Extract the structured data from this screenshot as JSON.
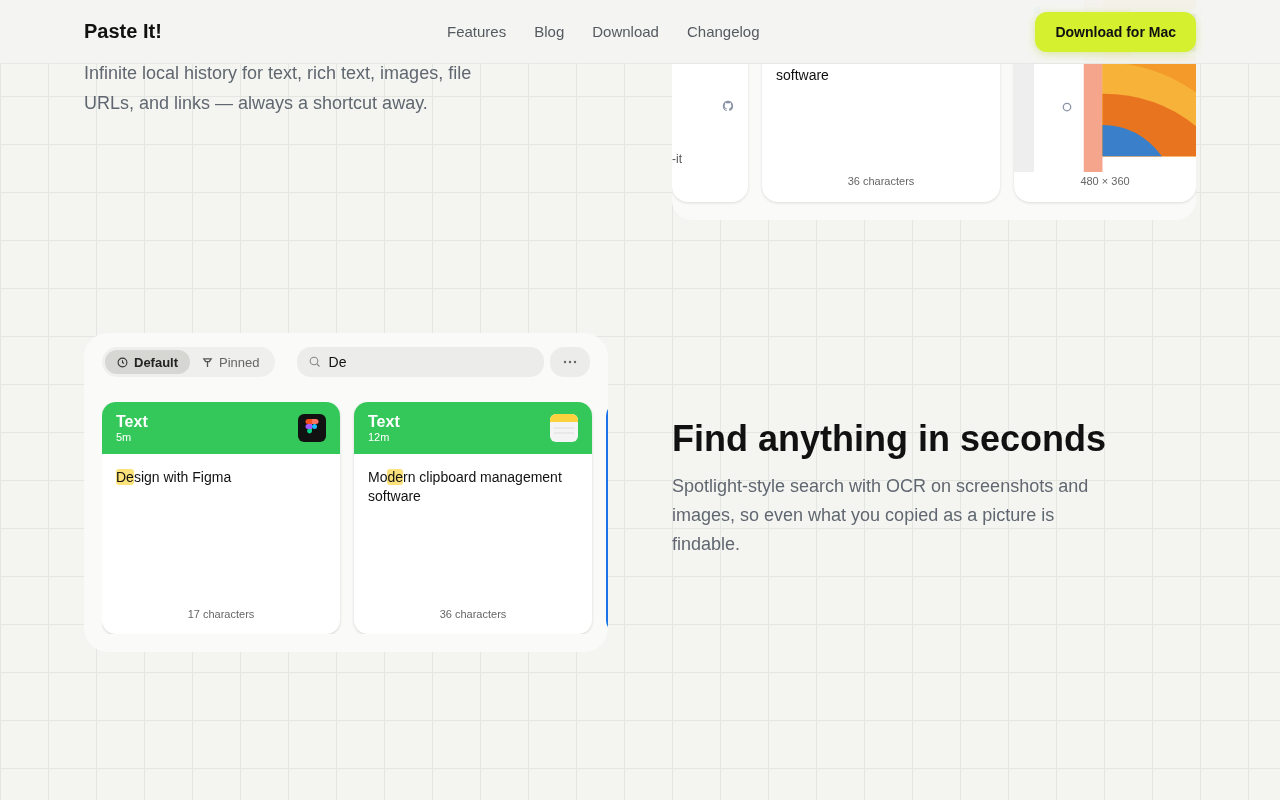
{
  "header": {
    "logo": "Paste It!",
    "nav": [
      {
        "label": "Features"
      },
      {
        "label": "Blog"
      },
      {
        "label": "Download"
      },
      {
        "label": "Changelog"
      }
    ],
    "cta": "Download for Mac"
  },
  "intro": {
    "description": "Infinite local history for text, rich text, images, file URLs, and links — always a shortcut away.",
    "preview_cards": [
      {
        "kind": "link",
        "text": "-it"
      },
      {
        "kind": "text",
        "text": "software",
        "footer": "36 characters"
      },
      {
        "footer": "480 × 360"
      }
    ]
  },
  "search_demo": {
    "filters": [
      {
        "label": "Default",
        "selected": true
      },
      {
        "label": "Pinned",
        "selected": false
      }
    ],
    "search": {
      "value": "De"
    },
    "cards": [
      {
        "type": "Text",
        "time": "5m",
        "kind": "figma",
        "parts": [
          {
            "text": "De",
            "highlighted": true
          },
          {
            "text": "sign with Figma",
            "highlighted": false
          }
        ],
        "footer": "17 characters"
      },
      {
        "type": "Text",
        "time": "12m",
        "kind": "notes",
        "parts": [
          {
            "text": "Mo",
            "highlighted": false
          },
          {
            "text": "de",
            "highlighted": true
          },
          {
            "text": "rn clipboard management software",
            "highlighted": false
          }
        ],
        "footer": "36 characters"
      }
    ]
  },
  "feature": {
    "title": "Find anything in seconds",
    "description": "Spotlight-style search with OCR on screenshots and images, so even what you copied as a picture is findable."
  }
}
